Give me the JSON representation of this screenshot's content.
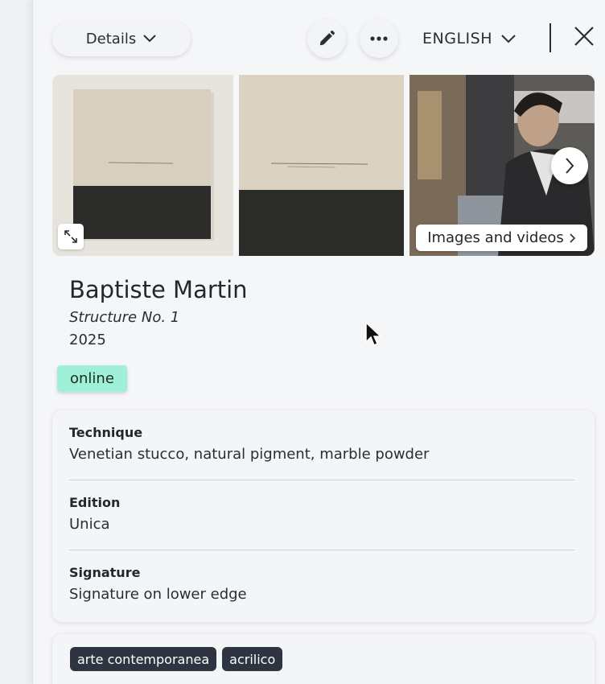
{
  "header": {
    "details_label": "Details",
    "language_label": "ENGLISH"
  },
  "gallery": {
    "media_link_label": "Images and videos"
  },
  "artwork": {
    "artist": "Baptiste Martin",
    "title": "Structure No. 1",
    "year": "2025",
    "status": "online"
  },
  "details": [
    {
      "label": "Technique",
      "value": "Venetian stucco, natural pigment, marble powder"
    },
    {
      "label": "Edition",
      "value": "Unica"
    },
    {
      "label": "Signature",
      "value": "Signature on lower edge"
    }
  ],
  "tags": [
    "arte contemporanea",
    "acrilico"
  ],
  "colors": {
    "status_badge": "#9ff0d7",
    "tag_background": "#2e3440"
  }
}
